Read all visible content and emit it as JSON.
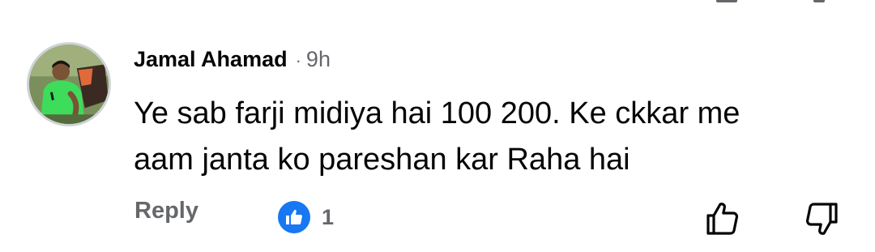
{
  "comment": {
    "author": "Jamal Ahamad",
    "separator": "·",
    "timestamp": "9h",
    "text": "Ye sab farji midiya hai 100 200. Ke ckkar me\naam janta ko pareshan kar Raha hai",
    "avatar_icon": "profile-photo"
  },
  "actions": {
    "reply_label": "Reply",
    "reaction_icon": "like-icon",
    "reaction_count": "1",
    "upvote_icon": "thumbs-up-outline-icon",
    "downvote_icon": "thumbs-down-outline-icon"
  },
  "colors": {
    "text_primary": "#050505",
    "text_secondary": "#65676b",
    "like_blue": "#1877f2",
    "background": "#ffffff"
  }
}
